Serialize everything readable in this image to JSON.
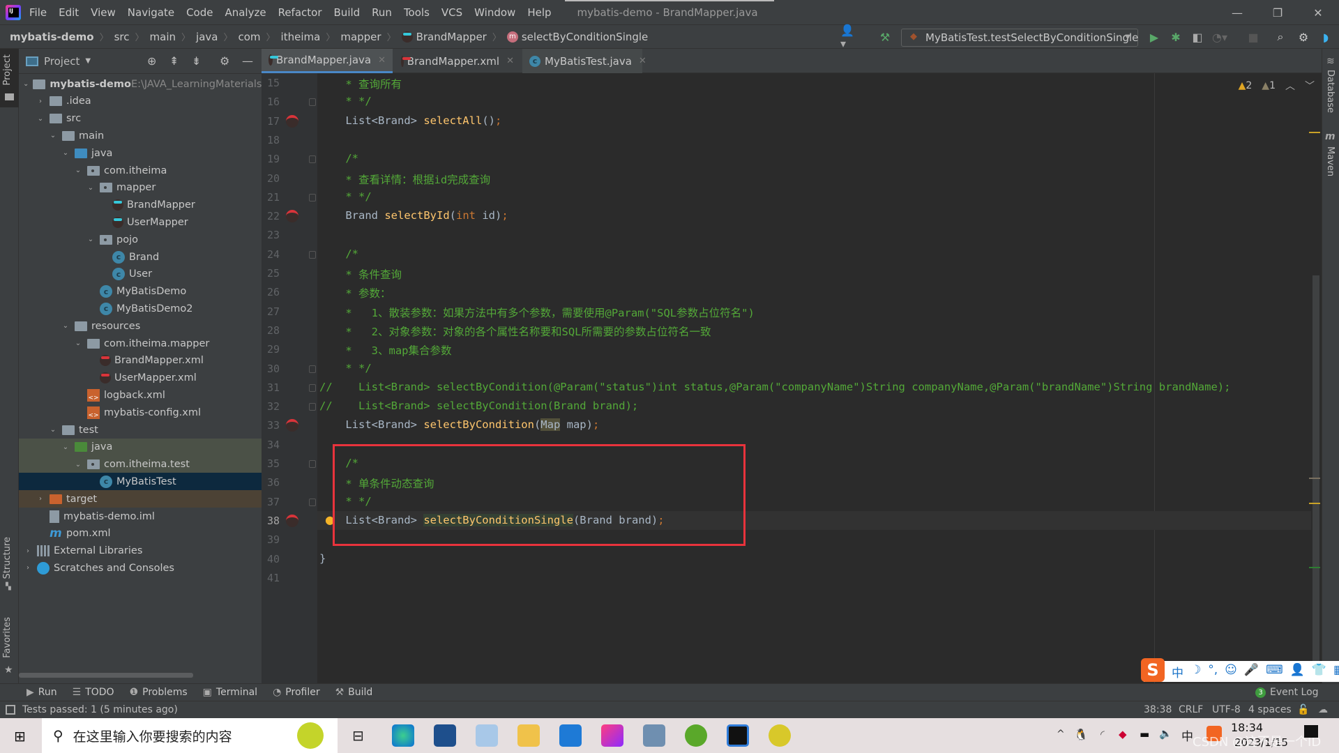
{
  "window": {
    "title": "mybatis-demo - BrandMapper.java",
    "menu": [
      "File",
      "Edit",
      "View",
      "Navigate",
      "Code",
      "Analyze",
      "Refactor",
      "Build",
      "Run",
      "Tools",
      "VCS",
      "Window",
      "Help"
    ],
    "controls": {
      "minimize": "—",
      "restore": "❐",
      "close": "✕"
    }
  },
  "breadcrumb": [
    "mybatis-demo",
    "src",
    "main",
    "java",
    "com",
    "itheima",
    "mapper",
    "BrandMapper",
    "selectByConditionSingle"
  ],
  "toolbar": {
    "run_config": "MyBatisTest.testSelectByConditionSingle",
    "icons": [
      "user-icon",
      "build-hammer-icon",
      "run-icon",
      "debug-icon",
      "coverage-icon",
      "profile-icon",
      "stop-icon",
      "search-icon",
      "settings-icon",
      "toolbox-icon"
    ]
  },
  "project_panel": {
    "title": "Project",
    "root_path": "E:\\JAVA_LearningMaterials_",
    "tree": [
      {
        "label": "mybatis-demo",
        "depth": 0,
        "arrow": "down",
        "icon": "module"
      },
      {
        "label": ".idea",
        "depth": 1,
        "arrow": "right",
        "icon": "folder"
      },
      {
        "label": "src",
        "depth": 1,
        "arrow": "down",
        "icon": "folder"
      },
      {
        "label": "main",
        "depth": 2,
        "arrow": "down",
        "icon": "folder"
      },
      {
        "label": "java",
        "depth": 3,
        "arrow": "down",
        "icon": "folder-blue"
      },
      {
        "label": "com.itheima",
        "depth": 4,
        "arrow": "down",
        "icon": "package"
      },
      {
        "label": "mapper",
        "depth": 5,
        "arrow": "down",
        "icon": "package"
      },
      {
        "label": "BrandMapper",
        "depth": 6,
        "arrow": "",
        "icon": "mapper"
      },
      {
        "label": "UserMapper",
        "depth": 6,
        "arrow": "",
        "icon": "mapper"
      },
      {
        "label": "pojo",
        "depth": 5,
        "arrow": "down",
        "icon": "package"
      },
      {
        "label": "Brand",
        "depth": 6,
        "arrow": "",
        "icon": "class"
      },
      {
        "label": "User",
        "depth": 6,
        "arrow": "",
        "icon": "class"
      },
      {
        "label": "MyBatisDemo",
        "depth": 5,
        "arrow": "",
        "icon": "class-run"
      },
      {
        "label": "MyBatisDemo2",
        "depth": 5,
        "arrow": "",
        "icon": "class-run"
      },
      {
        "label": "resources",
        "depth": 3,
        "arrow": "down",
        "icon": "folder-res"
      },
      {
        "label": "com.itheima.mapper",
        "depth": 4,
        "arrow": "down",
        "icon": "folder"
      },
      {
        "label": "BrandMapper.xml",
        "depth": 5,
        "arrow": "",
        "icon": "mapper-xml"
      },
      {
        "label": "UserMapper.xml",
        "depth": 5,
        "arrow": "",
        "icon": "mapper-xml"
      },
      {
        "label": "logback.xml",
        "depth": 4,
        "arrow": "",
        "icon": "xml"
      },
      {
        "label": "mybatis-config.xml",
        "depth": 4,
        "arrow": "",
        "icon": "xml"
      },
      {
        "label": "test",
        "depth": 2,
        "arrow": "down",
        "icon": "folder"
      },
      {
        "label": "java",
        "depth": 3,
        "arrow": "down",
        "icon": "folder-green"
      },
      {
        "label": "com.itheima.test",
        "depth": 4,
        "arrow": "down",
        "icon": "package"
      },
      {
        "label": "MyBatisTest",
        "depth": 5,
        "arrow": "",
        "icon": "class-test",
        "selected": true
      },
      {
        "label": "target",
        "depth": 1,
        "arrow": "right",
        "icon": "folder-orange"
      },
      {
        "label": "mybatis-demo.iml",
        "depth": 1,
        "arrow": "",
        "icon": "file"
      },
      {
        "label": "pom.xml",
        "depth": 1,
        "arrow": "",
        "icon": "maven"
      },
      {
        "label": "External Libraries",
        "depth": 0,
        "arrow": "right",
        "icon": "libs"
      },
      {
        "label": "Scratches and Consoles",
        "depth": 0,
        "arrow": "right",
        "icon": "scratch"
      }
    ]
  },
  "tabs": [
    {
      "label": "BrandMapper.java",
      "active": true
    },
    {
      "label": "BrandMapper.xml",
      "active": false
    },
    {
      "label": "MyBatisTest.java",
      "active": false
    }
  ],
  "inspections": {
    "warnings": "2",
    "weak_warnings": "1"
  },
  "editor": {
    "lines": [
      {
        "n": "15",
        "text": "    * 查询所有"
      },
      {
        "n": "16",
        "text": "    * */"
      },
      {
        "n": "17",
        "text": "    List<Brand> selectAll();"
      },
      {
        "n": "18",
        "text": ""
      },
      {
        "n": "19",
        "text": "    /*"
      },
      {
        "n": "20",
        "text": "    * 查看详情：根据id完成查询"
      },
      {
        "n": "21",
        "text": "    * */"
      },
      {
        "n": "22",
        "text": "    Brand selectById(int id);"
      },
      {
        "n": "23",
        "text": ""
      },
      {
        "n": "24",
        "text": "    /*"
      },
      {
        "n": "25",
        "text": "    * 条件查询"
      },
      {
        "n": "26",
        "text": "    * 参数："
      },
      {
        "n": "27",
        "text": "    *   1、散装参数：如果方法中有多个参数，需要使用@Param(\"SQL参数占位符名\")"
      },
      {
        "n": "28",
        "text": "    *   2、对象参数：对象的各个属性名称要和SQL所需要的参数占位符名一致"
      },
      {
        "n": "29",
        "text": "    *   3、map集合参数"
      },
      {
        "n": "30",
        "text": "    * */"
      },
      {
        "n": "31",
        "text": "//    List<Brand> selectByCondition(@Param(\"status\")int status,@Param(\"companyName\")String companyName,@Param(\"brandName\")String brandName);"
      },
      {
        "n": "32",
        "text": "//    List<Brand> selectByCondition(Brand brand);"
      },
      {
        "n": "33",
        "text": "    List<Brand> selectByCondition(Map map);"
      },
      {
        "n": "34",
        "text": ""
      },
      {
        "n": "35",
        "text": "    /*"
      },
      {
        "n": "36",
        "text": "    * 单条件动态查询"
      },
      {
        "n": "37",
        "text": "    * */"
      },
      {
        "n": "38",
        "text": "    List<Brand> selectByConditionSingle(Brand brand);"
      },
      {
        "n": "39",
        "text": ""
      },
      {
        "n": "40",
        "text": "}"
      },
      {
        "n": "41",
        "text": ""
      }
    ]
  },
  "right_strip": [
    "Database",
    "Maven"
  ],
  "left_strip": [
    "Project",
    "Structure",
    "Favorites"
  ],
  "bottom_tabs": [
    "Run",
    "TODO",
    "Problems",
    "Terminal",
    "Profiler",
    "Build"
  ],
  "event_log": {
    "count": "3",
    "label": "Event Log"
  },
  "status": {
    "message": "Tests passed: 1 (5 minutes ago)",
    "position": "38:38",
    "line_sep": "CRLF",
    "encoding": "UTF-8",
    "indent": "4 spaces"
  },
  "ime_bar": [
    "中",
    "☽",
    "°,",
    "☺",
    "🎤",
    "⌨",
    "👤",
    "👕",
    "▦"
  ],
  "taskbar": {
    "search_placeholder": "在这里输入你要搜索的内容",
    "time": "18:34",
    "date": "2023/1/15",
    "ime_lang": "中",
    "watermark": "CSDN @这不是一个ID"
  }
}
